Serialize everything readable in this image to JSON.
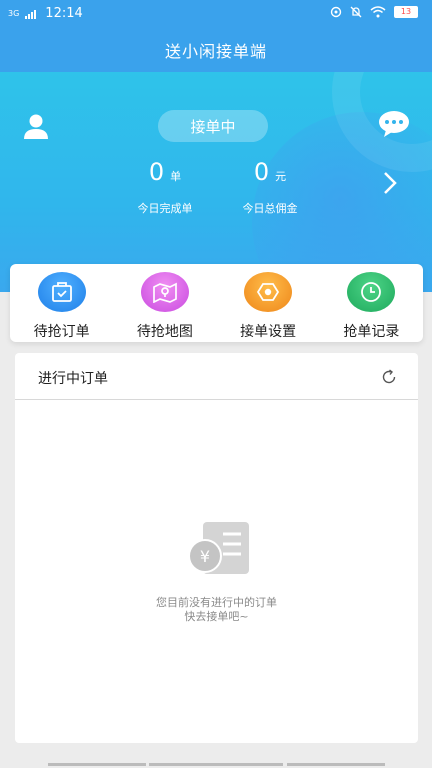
{
  "status_bar": {
    "time": "12:14",
    "network": "3G",
    "battery": "13"
  },
  "header": {
    "title": "送小闲接单端"
  },
  "hero": {
    "status_pill": "接单中",
    "stats": [
      {
        "value": "0",
        "unit": "单",
        "label": "今日完成单"
      },
      {
        "value": "0",
        "unit": "元",
        "label": "今日总佣金"
      }
    ]
  },
  "menu": {
    "items": [
      {
        "label": "待抢订单",
        "icon": "pending-orders-icon",
        "color": "#2c8ff0"
      },
      {
        "label": "待抢地图",
        "icon": "map-icon",
        "color": "#d45ee0"
      },
      {
        "label": "接单设置",
        "icon": "settings-icon",
        "color": "#f29a1d"
      },
      {
        "label": "抢单记录",
        "icon": "clock-icon",
        "color": "#27b567"
      }
    ]
  },
  "orders": {
    "title": "进行中订单",
    "empty_line1": "您目前没有进行中的订单",
    "empty_line2": "快去接单吧~"
  },
  "colors": {
    "primary": "#3aa2ec",
    "hero_gradient_top": "#2fc3ea"
  }
}
